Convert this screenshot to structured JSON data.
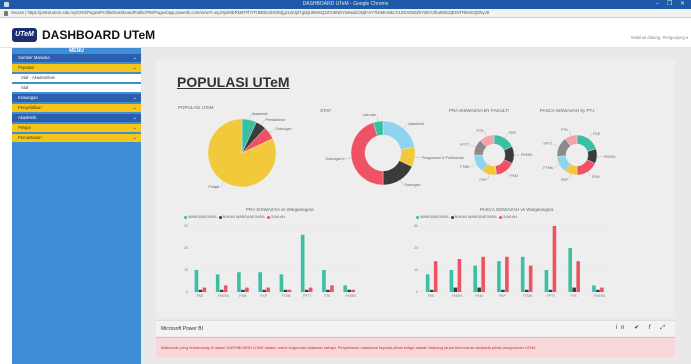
{
  "browser": {
    "window_title": "DASHBOARD UTeM - Google Chrome",
    "window_controls": "– ❐ ✕",
    "url": "Secure | https://portal.utem.edu.my/CRS/Pages/Profile/DashboardPublic/PBI/Pages/app.powerbi.com/view?r=eyJrIjoiMDRkMTFhYTctMDk4ZS00ZjgzLWJjZTgtZjU0MmQ2ZGI5NDYwIiwidCI6IjFmYTk0MmNkLTI1ZDAtNDZhYi05YzllLWM1ZjEzNTRkMGQ0NyJ9"
  },
  "header": {
    "logo_text": "UTeM",
    "title": "DASHBOARD UTeM",
    "user": "Selamat datang, Pengunjung",
    "caret": "▾"
  },
  "sidebar": {
    "menu_label": "MENU",
    "chevron": "⌄",
    "items": [
      {
        "label": "Sumber Manusia",
        "style": "blue",
        "chevron": true
      },
      {
        "label": "Populasi",
        "style": "yellow",
        "chevron": true
      },
      {
        "label": "Staf - Akademikan",
        "style": "sub",
        "chevron": false
      },
      {
        "label": "Staf",
        "style": "sub",
        "chevron": false
      },
      {
        "label": "Kewangan",
        "style": "blue",
        "chevron": true
      },
      {
        "label": "Penyelidikan",
        "style": "yellow",
        "chevron": true
      },
      {
        "label": "Akademik",
        "style": "blue",
        "chevron": true
      },
      {
        "label": "Pelajar",
        "style": "yellow",
        "chevron": true
      },
      {
        "label": "Pemantauan",
        "style": "yellow",
        "chevron": true
      }
    ]
  },
  "report": {
    "title": "POPULASI UTeM"
  },
  "colors": {
    "teal": "#3bbfa3",
    "dark": "#3b3b3b",
    "red": "#ef5363",
    "yellow": "#f2c93a",
    "gray": "#8a8a8a",
    "lightblue": "#8fd3ee",
    "sidebar": "#3d8ed6",
    "header_blue": "#2c5fae"
  },
  "chart_data": [
    {
      "type": "pie",
      "title": "POPULASI UTeM",
      "labels": [
        "Akademik",
        "Pentadbiran",
        "Sokongan",
        "Pelajar"
      ],
      "values": [
        7,
        5,
        6,
        82
      ],
      "colors": [
        "#3bbfa3",
        "#3b3b3b",
        "#ef5363",
        "#f2c93a"
      ]
    },
    {
      "type": "pie",
      "title": "STAF",
      "labels": [
        "Akademik",
        "Pengurusan & Profesional",
        "Sokongan",
        "Sokongan II",
        "Lain-lain"
      ],
      "values": [
        22,
        10,
        18,
        45,
        5
      ],
      "colors": [
        "#8fd3ee",
        "#f2c93a",
        "#3b3b3b",
        "#ef5363",
        "#3bbfa3"
      ]
    },
    {
      "type": "pie",
      "title": "PRA SISWAZAH BY FAKULTI",
      "labels": [
        "FKE",
        "FKEKK",
        "FKM",
        "FKP",
        "FTMK",
        "FPTT",
        "FTK"
      ],
      "values": [
        18,
        14,
        16,
        12,
        15,
        13,
        12
      ],
      "colors": [
        "#3bbfa3",
        "#3b3b3b",
        "#ef5363",
        "#f2c93a",
        "#8fd3ee",
        "#8a8a8a",
        "#f4a1a9"
      ]
    },
    {
      "type": "pie",
      "title": "PASCA SISWAZAH by PTJ",
      "labels": [
        "FKE",
        "FKEKK",
        "FKM",
        "FKP",
        "FTMK",
        "FPTT",
        "FTK"
      ],
      "values": [
        20,
        12,
        18,
        10,
        14,
        16,
        10
      ],
      "colors": [
        "#3bbfa3",
        "#3b3b3b",
        "#ef5363",
        "#f2c93a",
        "#8fd3ee",
        "#8a8a8a",
        "#f4a1a9"
      ]
    },
    {
      "type": "bar",
      "title": "PRA SISWAZAH vs Warganegara",
      "categories": [
        "FKE",
        "FKEKK",
        "FKM",
        "FKP",
        "FTMK",
        "FPTT",
        "FTK",
        "FKEKK"
      ],
      "ylim": [
        0,
        30
      ],
      "yticks": [
        "30",
        "20",
        "10",
        "0"
      ],
      "series": [
        {
          "name": "WARGANEGARA",
          "color": "#3bbfa3",
          "values": [
            10,
            8,
            9,
            9,
            8,
            26,
            10,
            3
          ]
        },
        {
          "name": "BUKAN WARGANEGARA",
          "color": "#3b3b3b",
          "values": [
            1,
            1,
            1,
            1,
            1,
            1,
            1,
            1
          ]
        },
        {
          "name": "JUMLAH",
          "color": "#ef5363",
          "values": [
            2,
            3,
            2,
            2,
            1,
            2,
            3,
            1
          ]
        }
      ]
    },
    {
      "type": "bar",
      "title": "PASCA SISWAZAH vs Warganegara",
      "categories": [
        "FKE",
        "FKEKK",
        "FKM",
        "FKP",
        "FTMK",
        "FPTT",
        "FTK",
        "FKEKK"
      ],
      "ylim": [
        0,
        30
      ],
      "yticks": [
        "30",
        "20",
        "10",
        "0"
      ],
      "series": [
        {
          "name": "WARGANEGARA",
          "color": "#3bbfa3",
          "values": [
            8,
            10,
            12,
            14,
            16,
            10,
            20,
            3
          ]
        },
        {
          "name": "BUKAN WARGANEGARA",
          "color": "#3b3b3b",
          "values": [
            1,
            2,
            2,
            1,
            1,
            1,
            2,
            1
          ]
        },
        {
          "name": "JUMLAH",
          "color": "#ef5363",
          "values": [
            14,
            15,
            16,
            16,
            12,
            30,
            14,
            2
          ]
        }
      ]
    }
  ],
  "footer": {
    "powerbi_label": "Microsoft Power BI",
    "share_icons": "in  ✔  f  ⤢",
    "notice": "Maklumat yang terkandung di dalam DASHBOARD UTeM adalah untuk kegunaan dalaman sahaja. Penyebaran maklumat kepada pihak ketiga adalah dilarang tanpa kebenaran daripada pihak pengurusan UTeM."
  }
}
